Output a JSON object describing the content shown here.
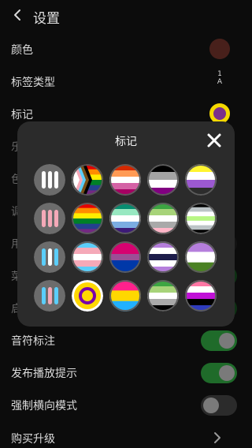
{
  "header": {
    "title": "设置"
  },
  "settings": {
    "color_label": "颜色",
    "label_type_label": "标签类型",
    "label_type_glyph": "1\nA",
    "marker_label": "标记",
    "hidden1": "乐",
    "hidden2": "色",
    "hidden3": "调",
    "hidden4": "用",
    "hidden5": "菜",
    "hidden6": "启",
    "note_label": "音符标注",
    "release_hint_label": "发布播放提示",
    "force_landscape_label": "强制横向模式",
    "buy_upgrade_label": "购买升级"
  },
  "dialog": {
    "title": "标记",
    "markers": [
      {
        "name": "white-pills-icon",
        "kind": "pills",
        "colors": [
          "#ffffff",
          "#ffffff",
          "#ffffff"
        ]
      },
      {
        "name": "progress-pride-flag-icon",
        "kind": "progress"
      },
      {
        "name": "lesbian-flag-icon",
        "kind": "stripes",
        "colors": [
          "#d62900",
          "#ff9b55",
          "#ffffff",
          "#d462a5",
          "#a50062"
        ]
      },
      {
        "name": "nonbinary-grey-flag-icon",
        "kind": "stripes",
        "colors": [
          "#000000",
          "#a4a4a4",
          "#ffffff",
          "#810081"
        ]
      },
      {
        "name": "nonbinary-flag-icon",
        "kind": "stripes",
        "colors": [
          "#fff430",
          "#ffffff",
          "#9c59d1",
          "#2c2c2c"
        ]
      },
      {
        "name": "pink-pills-icon",
        "kind": "pills",
        "colors": [
          "#f5a9b8",
          "#f5a9b8",
          "#f5a9b8"
        ]
      },
      {
        "name": "rainbow-pride-flag-icon",
        "kind": "stripes",
        "colors": [
          "#e40303",
          "#ff8c00",
          "#ffed00",
          "#008026",
          "#24408e",
          "#732982"
        ]
      },
      {
        "name": "gay-men-flag-icon",
        "kind": "stripes",
        "colors": [
          "#078d70",
          "#98e8c1",
          "#ffffff",
          "#7bade2",
          "#3d1a78"
        ]
      },
      {
        "name": "aromantic-flag-icon",
        "kind": "stripes",
        "colors": [
          "#3da542",
          "#a7d379",
          "#ffffff",
          "#a9a9a9",
          "#ffb6c8"
        ]
      },
      {
        "name": "agender-flag-icon",
        "kind": "stripes",
        "colors": [
          "#000000",
          "#bcc4c7",
          "#ffffff",
          "#b7f684",
          "#ffffff",
          "#bcc4c7",
          "#000000"
        ]
      },
      {
        "name": "blue-pills-icon",
        "kind": "pills",
        "colors": [
          "#5bcefa",
          "#ffffff",
          "#5bcefa"
        ]
      },
      {
        "name": "transgender-flag-icon",
        "kind": "stripes",
        "colors": [
          "#5bcefa",
          "#f5a9b8",
          "#ffffff",
          "#f5a9b8",
          "#5bcefa"
        ]
      },
      {
        "name": "bisexual-flag-icon",
        "kind": "stripes",
        "colors": [
          "#d60270",
          "#d60270",
          "#9b4f96",
          "#0038a8",
          "#0038a8"
        ]
      },
      {
        "name": "genderqueer-flag-icon",
        "kind": "stripes",
        "colors": [
          "#b57edc",
          "#ffffff",
          "#1c1c4a",
          "#ffffff",
          "#b57edc"
        ]
      },
      {
        "name": "genderqueer-green-flag-icon",
        "kind": "stripes",
        "colors": [
          "#b57edc",
          "#ffffff",
          "#4a8123"
        ]
      },
      {
        "name": "trans-pills-icon",
        "kind": "pills",
        "colors": [
          "#5bcefa",
          "#f5a9b8",
          "#5bcefa"
        ]
      },
      {
        "name": "intersex-flag-icon",
        "kind": "intersex"
      },
      {
        "name": "pansexual-flag-icon",
        "kind": "stripes",
        "colors": [
          "#ff218c",
          "#ffd800",
          "#21b1ff"
        ]
      },
      {
        "name": "aromantic-green-flag-icon",
        "kind": "stripes",
        "colors": [
          "#3da542",
          "#a7d379",
          "#ffffff",
          "#a9a9a9",
          "#000000"
        ]
      },
      {
        "name": "genderfluid-flag-icon",
        "kind": "stripes",
        "colors": [
          "#ff76a4",
          "#ffffff",
          "#c011d7",
          "#000000",
          "#2f3cbe"
        ]
      }
    ]
  }
}
